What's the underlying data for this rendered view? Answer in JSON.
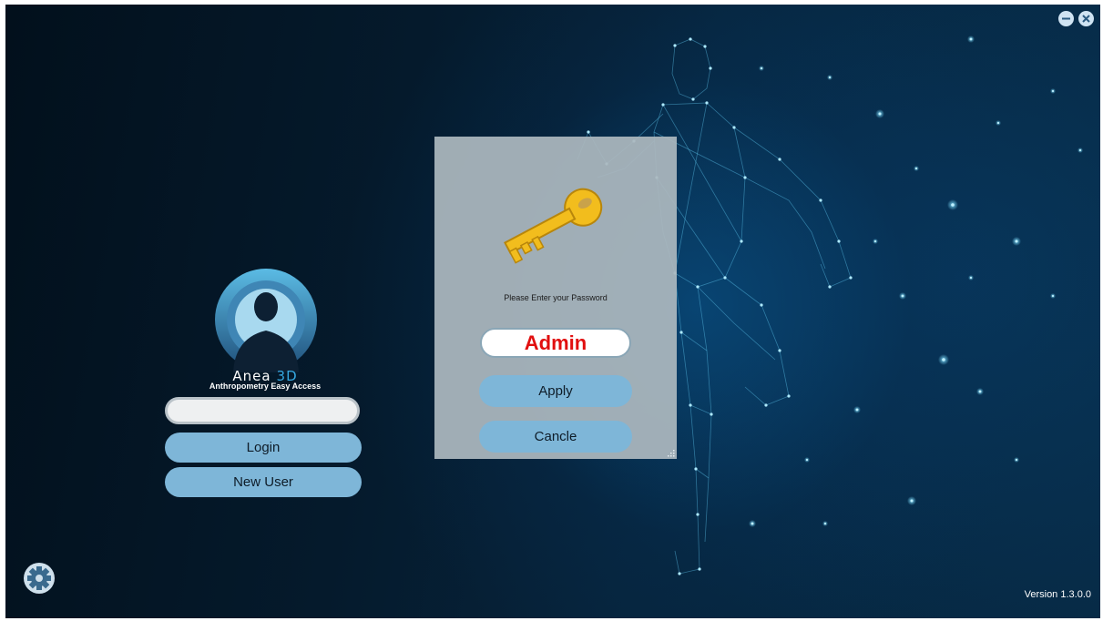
{
  "window": {
    "controls": [
      {
        "name": "minimize",
        "icon": "minimize-icon"
      },
      {
        "name": "close",
        "icon": "close-icon"
      }
    ]
  },
  "login": {
    "logo_icon": "user-silhouette-icon",
    "app_name": "Anea",
    "app_name_accent": "3D",
    "tagline": "Anthropometry Easy Access",
    "username_value": "",
    "login_label": "Login",
    "new_user_label": "New User"
  },
  "dialog": {
    "icon": "key-icon",
    "prompt": "Please Enter your Password",
    "password_value": "Admin",
    "apply_label": "Apply",
    "cancel_label": "Cancle"
  },
  "footer": {
    "settings_icon": "gear-icon",
    "version": "Version 1.3.0.0"
  },
  "colors": {
    "button": "#7eb6d8",
    "accent": "#35a7e0",
    "password_text": "#e10f0f",
    "key": "#f2bd1d"
  }
}
